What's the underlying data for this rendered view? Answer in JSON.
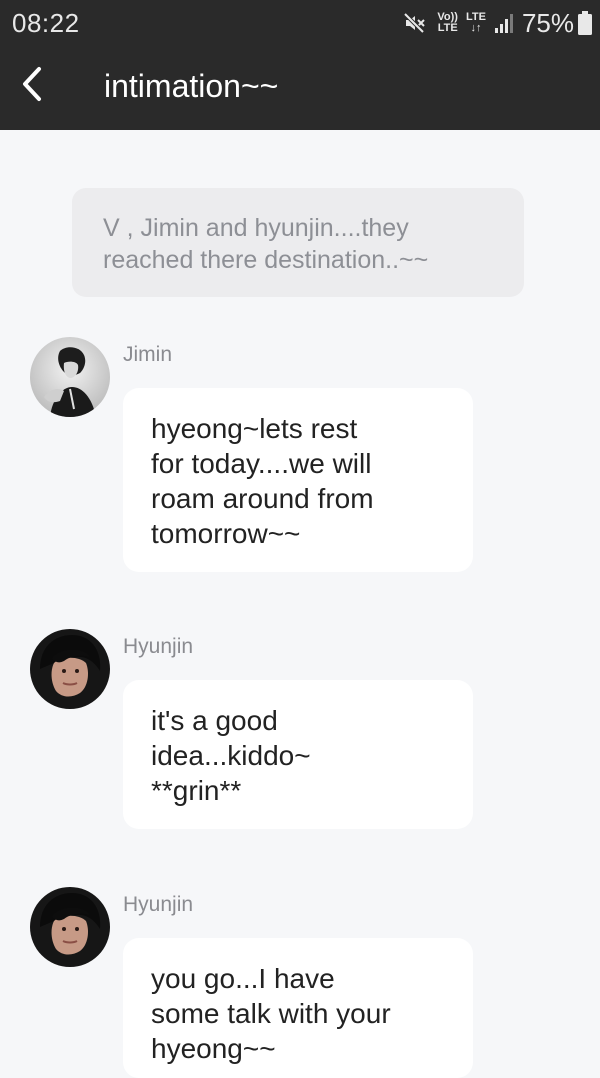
{
  "status_bar": {
    "time": "08:22",
    "lte_top": "Vo))",
    "lte_bottom": "LTE",
    "network_top": "LTE",
    "network_bottom": "↓↑",
    "battery_percent": "75%",
    "icons": [
      "mute-icon",
      "signal-icon",
      "battery-icon"
    ]
  },
  "header": {
    "title": "intimation~~",
    "back_icon": "chevron-left-icon"
  },
  "chat": {
    "system_note": {
      "lines": [
        "V , Jimin and hyunjin....they",
        "reached there destination..~~"
      ]
    },
    "messages": [
      {
        "sender": "Jimin",
        "avatar": "avatar-jimin",
        "lines": [
          "hyeong~lets rest",
          "for today....we will",
          "roam around from",
          "tomorrow~~"
        ]
      },
      {
        "sender": "Hyunjin",
        "avatar": "avatar-hyunjin",
        "lines": [
          "it's a good",
          "idea...kiddo~",
          "**grin**"
        ]
      },
      {
        "sender": "Hyunjin",
        "avatar": "avatar-hyunjin",
        "lines": [
          "you go...I have",
          "some talk with your",
          "hyeong~~"
        ]
      }
    ]
  },
  "colors": {
    "bar_background": "#2a2a2a",
    "page_background": "#f6f7f9",
    "system_note_background": "#ececee",
    "bubble_background": "#ffffff"
  }
}
